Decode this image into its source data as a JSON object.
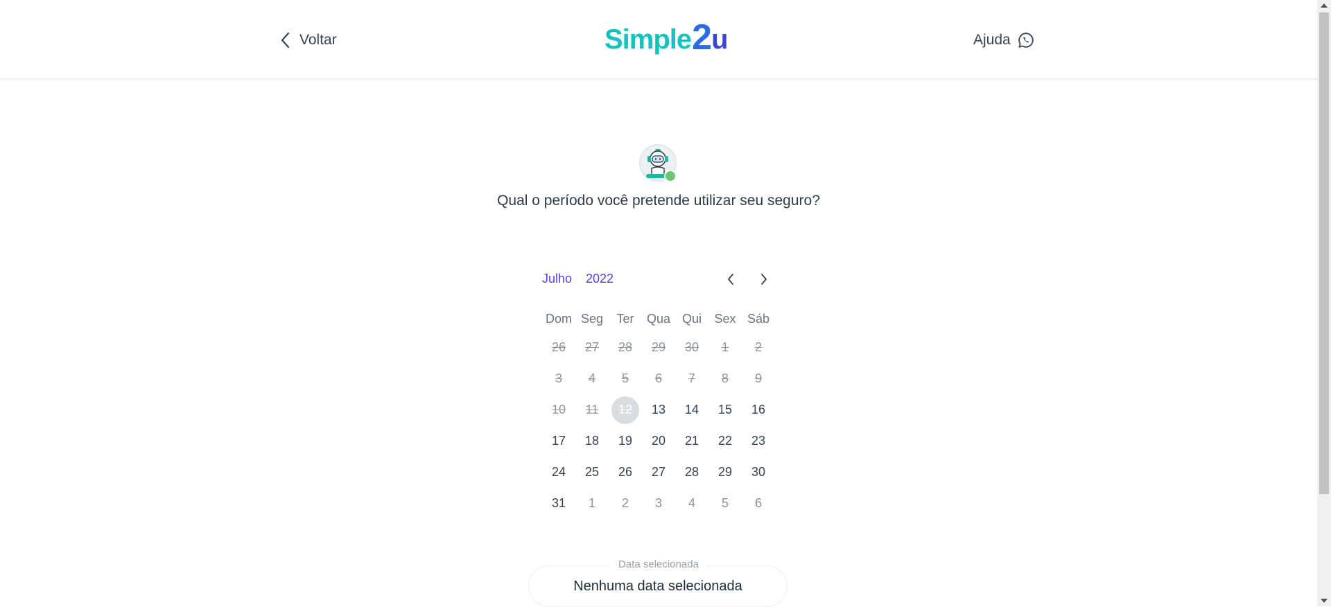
{
  "header": {
    "back_label": "Voltar",
    "logo": {
      "part1": "Simple",
      "part2": "2",
      "part3": "u"
    },
    "help_label": "Ajuda"
  },
  "question": "Qual o período você pretende utilizar seu seguro?",
  "calendar": {
    "month": "Julho",
    "year": "2022",
    "weekdays": [
      "Dom",
      "Seg",
      "Ter",
      "Qua",
      "Qui",
      "Sex",
      "Sáb"
    ],
    "weeks": [
      [
        {
          "d": "26",
          "s": "disabled"
        },
        {
          "d": "27",
          "s": "disabled"
        },
        {
          "d": "28",
          "s": "disabled"
        },
        {
          "d": "29",
          "s": "disabled"
        },
        {
          "d": "30",
          "s": "disabled"
        },
        {
          "d": "1",
          "s": "disabled"
        },
        {
          "d": "2",
          "s": "disabled"
        }
      ],
      [
        {
          "d": "3",
          "s": "disabled"
        },
        {
          "d": "4",
          "s": "disabled"
        },
        {
          "d": "5",
          "s": "disabled"
        },
        {
          "d": "6",
          "s": "disabled"
        },
        {
          "d": "7",
          "s": "disabled"
        },
        {
          "d": "8",
          "s": "disabled"
        },
        {
          "d": "9",
          "s": "disabled"
        }
      ],
      [
        {
          "d": "10",
          "s": "disabled"
        },
        {
          "d": "11",
          "s": "disabled"
        },
        {
          "d": "12",
          "s": "today"
        },
        {
          "d": "13",
          "s": "active"
        },
        {
          "d": "14",
          "s": "active"
        },
        {
          "d": "15",
          "s": "active"
        },
        {
          "d": "16",
          "s": "active"
        }
      ],
      [
        {
          "d": "17",
          "s": "active"
        },
        {
          "d": "18",
          "s": "active"
        },
        {
          "d": "19",
          "s": "active"
        },
        {
          "d": "20",
          "s": "active"
        },
        {
          "d": "21",
          "s": "active"
        },
        {
          "d": "22",
          "s": "active"
        },
        {
          "d": "23",
          "s": "active"
        }
      ],
      [
        {
          "d": "24",
          "s": "active"
        },
        {
          "d": "25",
          "s": "active"
        },
        {
          "d": "26",
          "s": "active"
        },
        {
          "d": "27",
          "s": "active"
        },
        {
          "d": "28",
          "s": "active"
        },
        {
          "d": "29",
          "s": "active"
        },
        {
          "d": "30",
          "s": "active"
        }
      ],
      [
        {
          "d": "31",
          "s": "active"
        },
        {
          "d": "1",
          "s": "outside"
        },
        {
          "d": "2",
          "s": "outside"
        },
        {
          "d": "3",
          "s": "outside"
        },
        {
          "d": "4",
          "s": "outside"
        },
        {
          "d": "5",
          "s": "outside"
        },
        {
          "d": "6",
          "s": "outside"
        }
      ]
    ]
  },
  "selection": {
    "label": "Data selecionada",
    "value": "Nenhuma data selecionada"
  },
  "icons": {
    "back": "chevron-left-icon",
    "help": "whatsapp-icon",
    "prev": "chevron-left-icon",
    "next": "chevron-right-icon"
  },
  "colors": {
    "accent": "#5a3cf0",
    "logo_teal": "#12c4bd",
    "logo_blue": "#2d6ce6",
    "online": "#6cc56f"
  }
}
